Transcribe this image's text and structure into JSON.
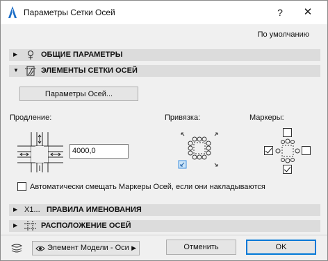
{
  "window": {
    "title": "Параметры Сетки Осей",
    "help_label": "?",
    "close_label": "✕",
    "default_label": "По умолчанию"
  },
  "sections": {
    "general": {
      "label": "ОБЩИЕ ПАРАМЕТРЫ",
      "expanded": false,
      "icon": "pin-icon"
    },
    "elements": {
      "label": "ЭЛЕМЕНТЫ СЕТКИ ОСЕЙ",
      "expanded": true,
      "icon": "grid-element-icon"
    },
    "naming": {
      "label": "ПРАВИЛА ИМЕНОВАНИЯ",
      "expanded": false,
      "icon_text": "X1..."
    },
    "layout": {
      "label": "РАСПОЛОЖЕНИЕ ОСЕЙ",
      "expanded": false,
      "icon": "grid-layout-icon"
    }
  },
  "elements_panel": {
    "axis_params_button": "Параметры Осей...",
    "extension_label": "Продление:",
    "extension_value": "4000,0",
    "anchor_label": "Привязка:",
    "anchor_selected": "bottom-left",
    "markers_label": "Маркеры:",
    "markers": {
      "top": false,
      "left": true,
      "right": false,
      "bottom": true
    },
    "auto_offset_label": "Автоматически смещать Маркеры Осей, если они накладываются",
    "auto_offset_checked": false
  },
  "footer": {
    "layer_dropdown": "Элемент Модели - Оси",
    "cancel_label": "Отменить",
    "ok_label": "OK"
  },
  "colors": {
    "accent": "#0078d7",
    "section_bar": "#dcdcdc",
    "background": "#f0f0f0"
  }
}
